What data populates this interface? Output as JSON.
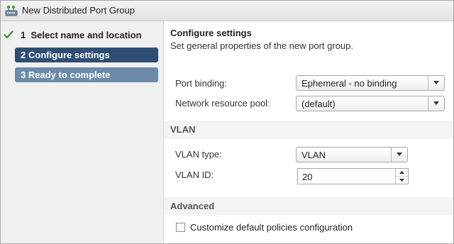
{
  "window": {
    "title": "New Distributed Port Group"
  },
  "steps": [
    {
      "number": "1",
      "label": "Select name and location",
      "status": "completed"
    },
    {
      "number": "2",
      "label": "Configure settings",
      "status": "active"
    },
    {
      "number": "3",
      "label": "Ready to complete",
      "status": "upcoming"
    }
  ],
  "content": {
    "title": "Configure settings",
    "subtitle": "Set general properties of the new port group.",
    "port_binding": {
      "label": "Port binding:",
      "value": "Ephemeral - no binding"
    },
    "network_resource_pool": {
      "label": "Network resource pool:",
      "value": "(default)"
    },
    "vlan_section": {
      "title": "VLAN",
      "vlan_type": {
        "label": "VLAN type:",
        "value": "VLAN"
      },
      "vlan_id": {
        "label": "VLAN ID:",
        "value": "20"
      }
    },
    "advanced_section": {
      "title": "Advanced",
      "customize_checkbox": {
        "label": "Customize default policies configuration",
        "checked": false
      }
    }
  },
  "colors": {
    "active_step": "#2e4e73",
    "upcoming_step": "#6c8bab",
    "check": "#3a8a2e"
  },
  "icons": [
    "distributed-port-group-icon",
    "checkmark-icon",
    "dropdown-arrow-icon",
    "spinner-up-icon",
    "spinner-down-icon"
  ]
}
